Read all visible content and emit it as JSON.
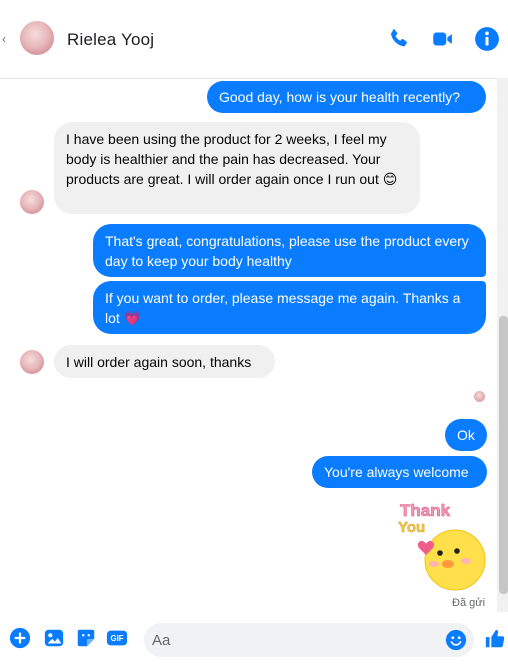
{
  "header": {
    "contact_name": "Rielea Yooj",
    "actions": [
      "phone-icon",
      "video-camera-icon",
      "info-icon"
    ]
  },
  "colors": {
    "accent": "#0a7cff",
    "incoming_bubble": "#f0f0f0"
  },
  "messages": [
    {
      "direction": "out",
      "text": "Good day, how is your health recently?"
    },
    {
      "direction": "in",
      "text": "I have been using the product for 2 weeks, I feel my body is healthier and the pain has decreased. Your products are great. I will order again once I run out",
      "emoji": "😊"
    },
    {
      "direction": "out",
      "text": "That's great, congratulations, please use the product every day to keep your body healthy"
    },
    {
      "direction": "out",
      "text": "If you want to order, please message me again. Thanks a lot",
      "emoji": "💗"
    },
    {
      "direction": "in",
      "text": "I will order again soon, thanks"
    },
    {
      "direction": "out",
      "text": "Ok"
    },
    {
      "direction": "out",
      "text": "You're always welcome"
    }
  ],
  "sticker": {
    "text_line1": "Thank",
    "text_line2": "You"
  },
  "status": {
    "sent_label": "Đã gửi"
  },
  "composer": {
    "placeholder": "Aa",
    "tools": [
      "plus-icon",
      "image-icon",
      "sticker-icon",
      "gif-icon"
    ],
    "gif_label": "GIF"
  }
}
